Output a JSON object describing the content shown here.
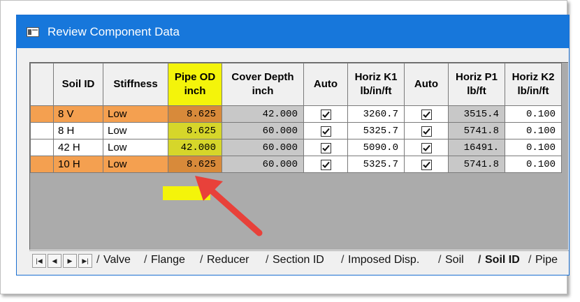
{
  "window": {
    "title": "Review Component Data"
  },
  "grid": {
    "headers": [
      {
        "l1": "",
        "l2": ""
      },
      {
        "l1": "Soil ID",
        "l2": ""
      },
      {
        "l1": "Stiffness",
        "l2": ""
      },
      {
        "l1": "Pipe OD",
        "l2": "inch"
      },
      {
        "l1": "Cover Depth",
        "l2": "inch"
      },
      {
        "l1": "Auto",
        "l2": ""
      },
      {
        "l1": "Horiz K1",
        "l2": "lb/in/ft"
      },
      {
        "l1": "Auto",
        "l2": ""
      },
      {
        "l1": "Horiz P1",
        "l2": "lb/ft"
      },
      {
        "l1": "Horiz K2",
        "l2": "lb/in/ft"
      }
    ],
    "rows": [
      {
        "soil_id": "8 V",
        "stiffness": "Low",
        "pipe_od": "8.625",
        "cover_depth": "42.000",
        "horiz_k1": "3260.7",
        "horiz_p1": "3515.4",
        "horiz_k2": "0.100"
      },
      {
        "soil_id": "8 H",
        "stiffness": "Low",
        "pipe_od": "8.625",
        "cover_depth": "60.000",
        "horiz_k1": "5325.7",
        "horiz_p1": "5741.8",
        "horiz_k2": "0.100"
      },
      {
        "soil_id": "42 H",
        "stiffness": "Low",
        "pipe_od": "42.000",
        "cover_depth": "60.000",
        "horiz_k1": "5090.0",
        "horiz_p1": "16491.",
        "horiz_k2": "0.100"
      },
      {
        "soil_id": "10 H",
        "stiffness": "Low",
        "pipe_od": "8.625",
        "cover_depth": "60.000",
        "horiz_k1": "5325.7",
        "horiz_p1": "5741.8",
        "horiz_k2": "0.100"
      }
    ]
  },
  "tabs": [
    "Valve",
    "Flange",
    "Reducer",
    "Section ID",
    "Imposed Disp.",
    "Soil",
    "Soil ID",
    "Pipe"
  ],
  "active_tab": "Soil ID",
  "nav_buttons": [
    "first-icon",
    "prev-icon",
    "next-icon",
    "last-icon"
  ],
  "colors": {
    "highlight_yellow": "#f4f40a",
    "highlight_orange": "#f59a3c",
    "arrow_red": "#e8413a",
    "titlebar": "#1777db"
  }
}
